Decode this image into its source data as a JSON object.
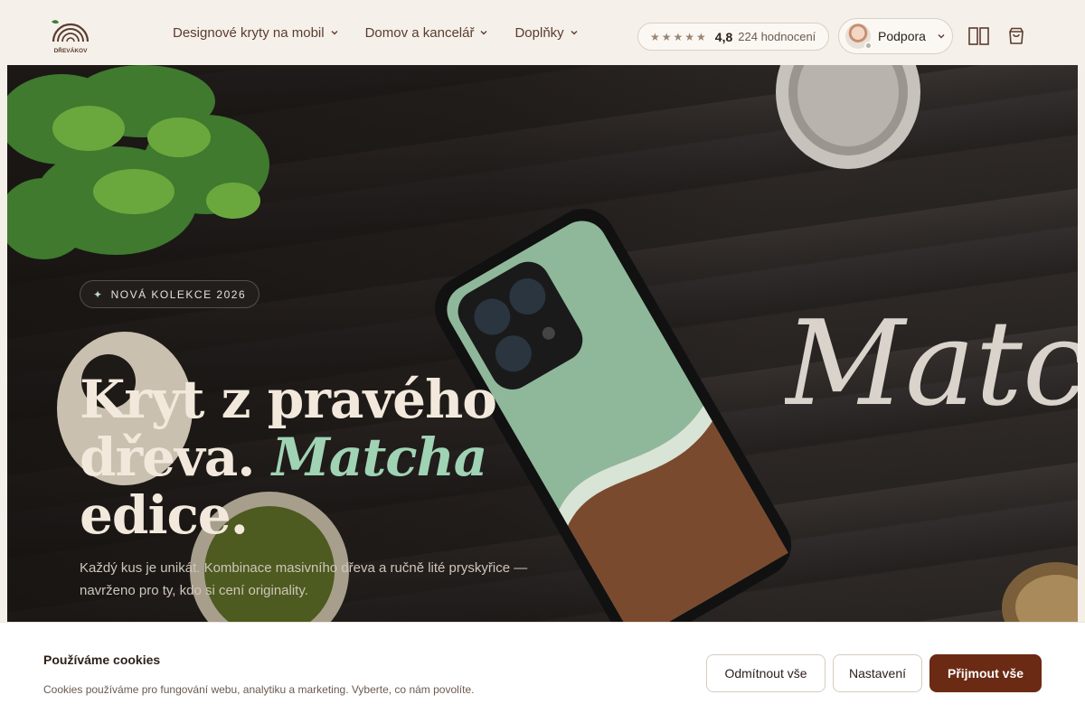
{
  "header": {
    "logo_text": "DŘEVÁKOV",
    "nav": [
      {
        "label": "Designové kryty na mobil",
        "icon": "chevron-down-icon"
      },
      {
        "label": "Domov a kancelář",
        "icon": "chevron-down-icon"
      },
      {
        "label": "Doplňky",
        "icon": "chevron-down-icon"
      }
    ],
    "rating": {
      "stars": "★★★★★",
      "score": "4,8",
      "count": "224 hodnocení"
    },
    "support": {
      "label": "Podpora",
      "icon": "chevron-down-icon"
    },
    "icons": [
      "compare-icon",
      "cart-icon"
    ]
  },
  "hero": {
    "badge": "NOVÁ KOLEKCE 2026",
    "badge_icon": "sparkle-icon",
    "headline_line1": "Kryt z pravého",
    "headline_line2_start": "dřeva.",
    "headline_line2_accent": "Matcha",
    "headline_line3": "edice.",
    "subtext": "Každý kus je unikát. Kombinace masivního dřeva a ručně lité pryskyřice — navrženo pro ty, kdo si cení originality.",
    "script_text": "Matcha",
    "colors": {
      "accent": "#9fd3b4",
      "headline": "#f2e9dc"
    }
  },
  "cookies": {
    "title": "Používáme cookies",
    "text": "Cookies používáme pro fungování webu, analytiku a marketing. Vyberte, co nám povolíte.",
    "reject_label": "Odmítnout vše",
    "settings_label": "Nastavení",
    "accept_label": "Přijmout vše",
    "accept_color": "#6b2a13"
  }
}
